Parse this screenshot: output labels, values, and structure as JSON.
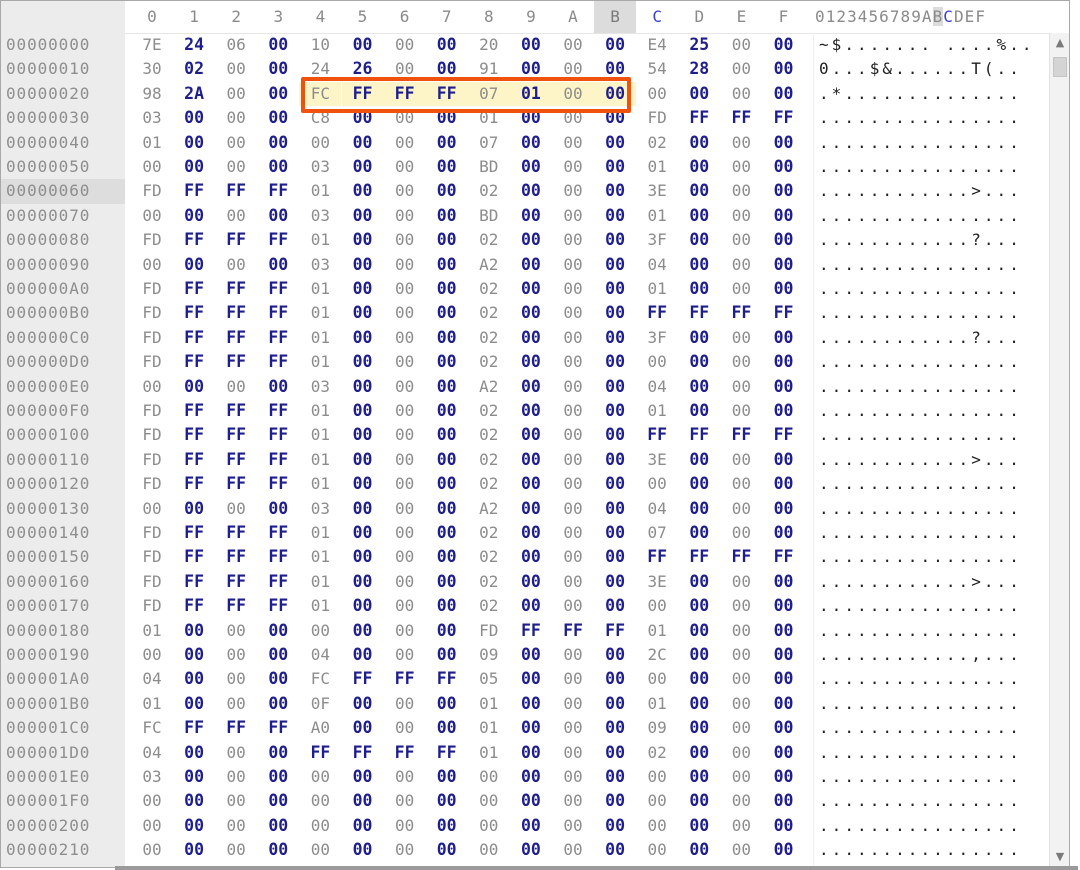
{
  "header": {
    "columns": [
      "0",
      "1",
      "2",
      "3",
      "4",
      "5",
      "6",
      "7",
      "8",
      "9",
      "A",
      "B",
      "C",
      "D",
      "E",
      "F"
    ],
    "ascii_header": "0123456789ABCDEF",
    "selected_column": "B",
    "cursor_column": "C"
  },
  "highlight": {
    "start_offset": "00000024",
    "end_offset": "0000002B",
    "color": "#f0510c"
  },
  "cursor_row": "00000060",
  "colors": {
    "bold_byte": "#1e1e8c",
    "normal_byte": "#8c8c8c",
    "highlight_fill": "#fdf5c7",
    "highlight_border": "#f0510c"
  },
  "scrollbar": {
    "up_icon": "triangle-up",
    "down_icon": "triangle-down"
  },
  "rows": [
    {
      "offset": "00000000",
      "bytes": [
        "7E",
        "24",
        "06",
        "00",
        "10",
        "00",
        "00",
        "00",
        "20",
        "00",
        "00",
        "00",
        "E4",
        "25",
        "00",
        "00"
      ],
      "ascii": "~$....... ....%.."
    },
    {
      "offset": "00000010",
      "bytes": [
        "30",
        "02",
        "00",
        "00",
        "24",
        "26",
        "00",
        "00",
        "91",
        "00",
        "00",
        "00",
        "54",
        "28",
        "00",
        "00"
      ],
      "ascii": "0...$&......T(.."
    },
    {
      "offset": "00000020",
      "bytes": [
        "98",
        "2A",
        "00",
        "00",
        "FC",
        "FF",
        "FF",
        "FF",
        "07",
        "01",
        "00",
        "00",
        "00",
        "00",
        "00",
        "00"
      ],
      "ascii": ".*.............."
    },
    {
      "offset": "00000030",
      "bytes": [
        "03",
        "00",
        "00",
        "00",
        "C8",
        "00",
        "00",
        "00",
        "01",
        "00",
        "00",
        "00",
        "FD",
        "FF",
        "FF",
        "FF"
      ],
      "ascii": "................"
    },
    {
      "offset": "00000040",
      "bytes": [
        "01",
        "00",
        "00",
        "00",
        "00",
        "00",
        "00",
        "00",
        "07",
        "00",
        "00",
        "00",
        "02",
        "00",
        "00",
        "00"
      ],
      "ascii": "................"
    },
    {
      "offset": "00000050",
      "bytes": [
        "00",
        "00",
        "00",
        "00",
        "03",
        "00",
        "00",
        "00",
        "BD",
        "00",
        "00",
        "00",
        "01",
        "00",
        "00",
        "00"
      ],
      "ascii": "................"
    },
    {
      "offset": "00000060",
      "bytes": [
        "FD",
        "FF",
        "FF",
        "FF",
        "01",
        "00",
        "00",
        "00",
        "02",
        "00",
        "00",
        "00",
        "3E",
        "00",
        "00",
        "00"
      ],
      "ascii": "............>..."
    },
    {
      "offset": "00000070",
      "bytes": [
        "00",
        "00",
        "00",
        "00",
        "03",
        "00",
        "00",
        "00",
        "BD",
        "00",
        "00",
        "00",
        "01",
        "00",
        "00",
        "00"
      ],
      "ascii": "................"
    },
    {
      "offset": "00000080",
      "bytes": [
        "FD",
        "FF",
        "FF",
        "FF",
        "01",
        "00",
        "00",
        "00",
        "02",
        "00",
        "00",
        "00",
        "3F",
        "00",
        "00",
        "00"
      ],
      "ascii": "............?..."
    },
    {
      "offset": "00000090",
      "bytes": [
        "00",
        "00",
        "00",
        "00",
        "03",
        "00",
        "00",
        "00",
        "A2",
        "00",
        "00",
        "00",
        "04",
        "00",
        "00",
        "00"
      ],
      "ascii": "................"
    },
    {
      "offset": "000000A0",
      "bytes": [
        "FD",
        "FF",
        "FF",
        "FF",
        "01",
        "00",
        "00",
        "00",
        "02",
        "00",
        "00",
        "00",
        "01",
        "00",
        "00",
        "00"
      ],
      "ascii": "................"
    },
    {
      "offset": "000000B0",
      "bytes": [
        "FD",
        "FF",
        "FF",
        "FF",
        "01",
        "00",
        "00",
        "00",
        "02",
        "00",
        "00",
        "00",
        "FF",
        "FF",
        "FF",
        "FF"
      ],
      "ascii": "................"
    },
    {
      "offset": "000000C0",
      "bytes": [
        "FD",
        "FF",
        "FF",
        "FF",
        "01",
        "00",
        "00",
        "00",
        "02",
        "00",
        "00",
        "00",
        "3F",
        "00",
        "00",
        "00"
      ],
      "ascii": "............?..."
    },
    {
      "offset": "000000D0",
      "bytes": [
        "FD",
        "FF",
        "FF",
        "FF",
        "01",
        "00",
        "00",
        "00",
        "02",
        "00",
        "00",
        "00",
        "00",
        "00",
        "00",
        "00"
      ],
      "ascii": "................"
    },
    {
      "offset": "000000E0",
      "bytes": [
        "00",
        "00",
        "00",
        "00",
        "03",
        "00",
        "00",
        "00",
        "A2",
        "00",
        "00",
        "00",
        "04",
        "00",
        "00",
        "00"
      ],
      "ascii": "................"
    },
    {
      "offset": "000000F0",
      "bytes": [
        "FD",
        "FF",
        "FF",
        "FF",
        "01",
        "00",
        "00",
        "00",
        "02",
        "00",
        "00",
        "00",
        "01",
        "00",
        "00",
        "00"
      ],
      "ascii": "................"
    },
    {
      "offset": "00000100",
      "bytes": [
        "FD",
        "FF",
        "FF",
        "FF",
        "01",
        "00",
        "00",
        "00",
        "02",
        "00",
        "00",
        "00",
        "FF",
        "FF",
        "FF",
        "FF"
      ],
      "ascii": "................"
    },
    {
      "offset": "00000110",
      "bytes": [
        "FD",
        "FF",
        "FF",
        "FF",
        "01",
        "00",
        "00",
        "00",
        "02",
        "00",
        "00",
        "00",
        "3E",
        "00",
        "00",
        "00"
      ],
      "ascii": "............>..."
    },
    {
      "offset": "00000120",
      "bytes": [
        "FD",
        "FF",
        "FF",
        "FF",
        "01",
        "00",
        "00",
        "00",
        "02",
        "00",
        "00",
        "00",
        "00",
        "00",
        "00",
        "00"
      ],
      "ascii": "................"
    },
    {
      "offset": "00000130",
      "bytes": [
        "00",
        "00",
        "00",
        "00",
        "03",
        "00",
        "00",
        "00",
        "A2",
        "00",
        "00",
        "00",
        "04",
        "00",
        "00",
        "00"
      ],
      "ascii": "................"
    },
    {
      "offset": "00000140",
      "bytes": [
        "FD",
        "FF",
        "FF",
        "FF",
        "01",
        "00",
        "00",
        "00",
        "02",
        "00",
        "00",
        "00",
        "07",
        "00",
        "00",
        "00"
      ],
      "ascii": "................"
    },
    {
      "offset": "00000150",
      "bytes": [
        "FD",
        "FF",
        "FF",
        "FF",
        "01",
        "00",
        "00",
        "00",
        "02",
        "00",
        "00",
        "00",
        "FF",
        "FF",
        "FF",
        "FF"
      ],
      "ascii": "................"
    },
    {
      "offset": "00000160",
      "bytes": [
        "FD",
        "FF",
        "FF",
        "FF",
        "01",
        "00",
        "00",
        "00",
        "02",
        "00",
        "00",
        "00",
        "3E",
        "00",
        "00",
        "00"
      ],
      "ascii": "............>..."
    },
    {
      "offset": "00000170",
      "bytes": [
        "FD",
        "FF",
        "FF",
        "FF",
        "01",
        "00",
        "00",
        "00",
        "02",
        "00",
        "00",
        "00",
        "00",
        "00",
        "00",
        "00"
      ],
      "ascii": "................"
    },
    {
      "offset": "00000180",
      "bytes": [
        "01",
        "00",
        "00",
        "00",
        "00",
        "00",
        "00",
        "00",
        "FD",
        "FF",
        "FF",
        "FF",
        "01",
        "00",
        "00",
        "00"
      ],
      "ascii": "................"
    },
    {
      "offset": "00000190",
      "bytes": [
        "00",
        "00",
        "00",
        "00",
        "04",
        "00",
        "00",
        "00",
        "09",
        "00",
        "00",
        "00",
        "2C",
        "00",
        "00",
        "00"
      ],
      "ascii": "............,..."
    },
    {
      "offset": "000001A0",
      "bytes": [
        "04",
        "00",
        "00",
        "00",
        "FC",
        "FF",
        "FF",
        "FF",
        "05",
        "00",
        "00",
        "00",
        "00",
        "00",
        "00",
        "00"
      ],
      "ascii": "................"
    },
    {
      "offset": "000001B0",
      "bytes": [
        "01",
        "00",
        "00",
        "00",
        "0F",
        "00",
        "00",
        "00",
        "01",
        "00",
        "00",
        "00",
        "01",
        "00",
        "00",
        "00"
      ],
      "ascii": "................"
    },
    {
      "offset": "000001C0",
      "bytes": [
        "FC",
        "FF",
        "FF",
        "FF",
        "A0",
        "00",
        "00",
        "00",
        "01",
        "00",
        "00",
        "00",
        "09",
        "00",
        "00",
        "00"
      ],
      "ascii": "................"
    },
    {
      "offset": "000001D0",
      "bytes": [
        "04",
        "00",
        "00",
        "00",
        "FF",
        "FF",
        "FF",
        "FF",
        "01",
        "00",
        "00",
        "00",
        "02",
        "00",
        "00",
        "00"
      ],
      "ascii": "................"
    },
    {
      "offset": "000001E0",
      "bytes": [
        "03",
        "00",
        "00",
        "00",
        "00",
        "00",
        "00",
        "00",
        "00",
        "00",
        "00",
        "00",
        "00",
        "00",
        "00",
        "00"
      ],
      "ascii": "................"
    },
    {
      "offset": "000001F0",
      "bytes": [
        "00",
        "00",
        "00",
        "00",
        "00",
        "00",
        "00",
        "00",
        "00",
        "00",
        "00",
        "00",
        "00",
        "00",
        "00",
        "00"
      ],
      "ascii": "................"
    },
    {
      "offset": "00000200",
      "bytes": [
        "00",
        "00",
        "00",
        "00",
        "00",
        "00",
        "00",
        "00",
        "00",
        "00",
        "00",
        "00",
        "00",
        "00",
        "00",
        "00"
      ],
      "ascii": "................"
    },
    {
      "offset": "00000210",
      "bytes": [
        "00",
        "00",
        "00",
        "00",
        "00",
        "00",
        "00",
        "00",
        "00",
        "00",
        "00",
        "00",
        "00",
        "00",
        "00",
        "00"
      ],
      "ascii": "................"
    }
  ]
}
